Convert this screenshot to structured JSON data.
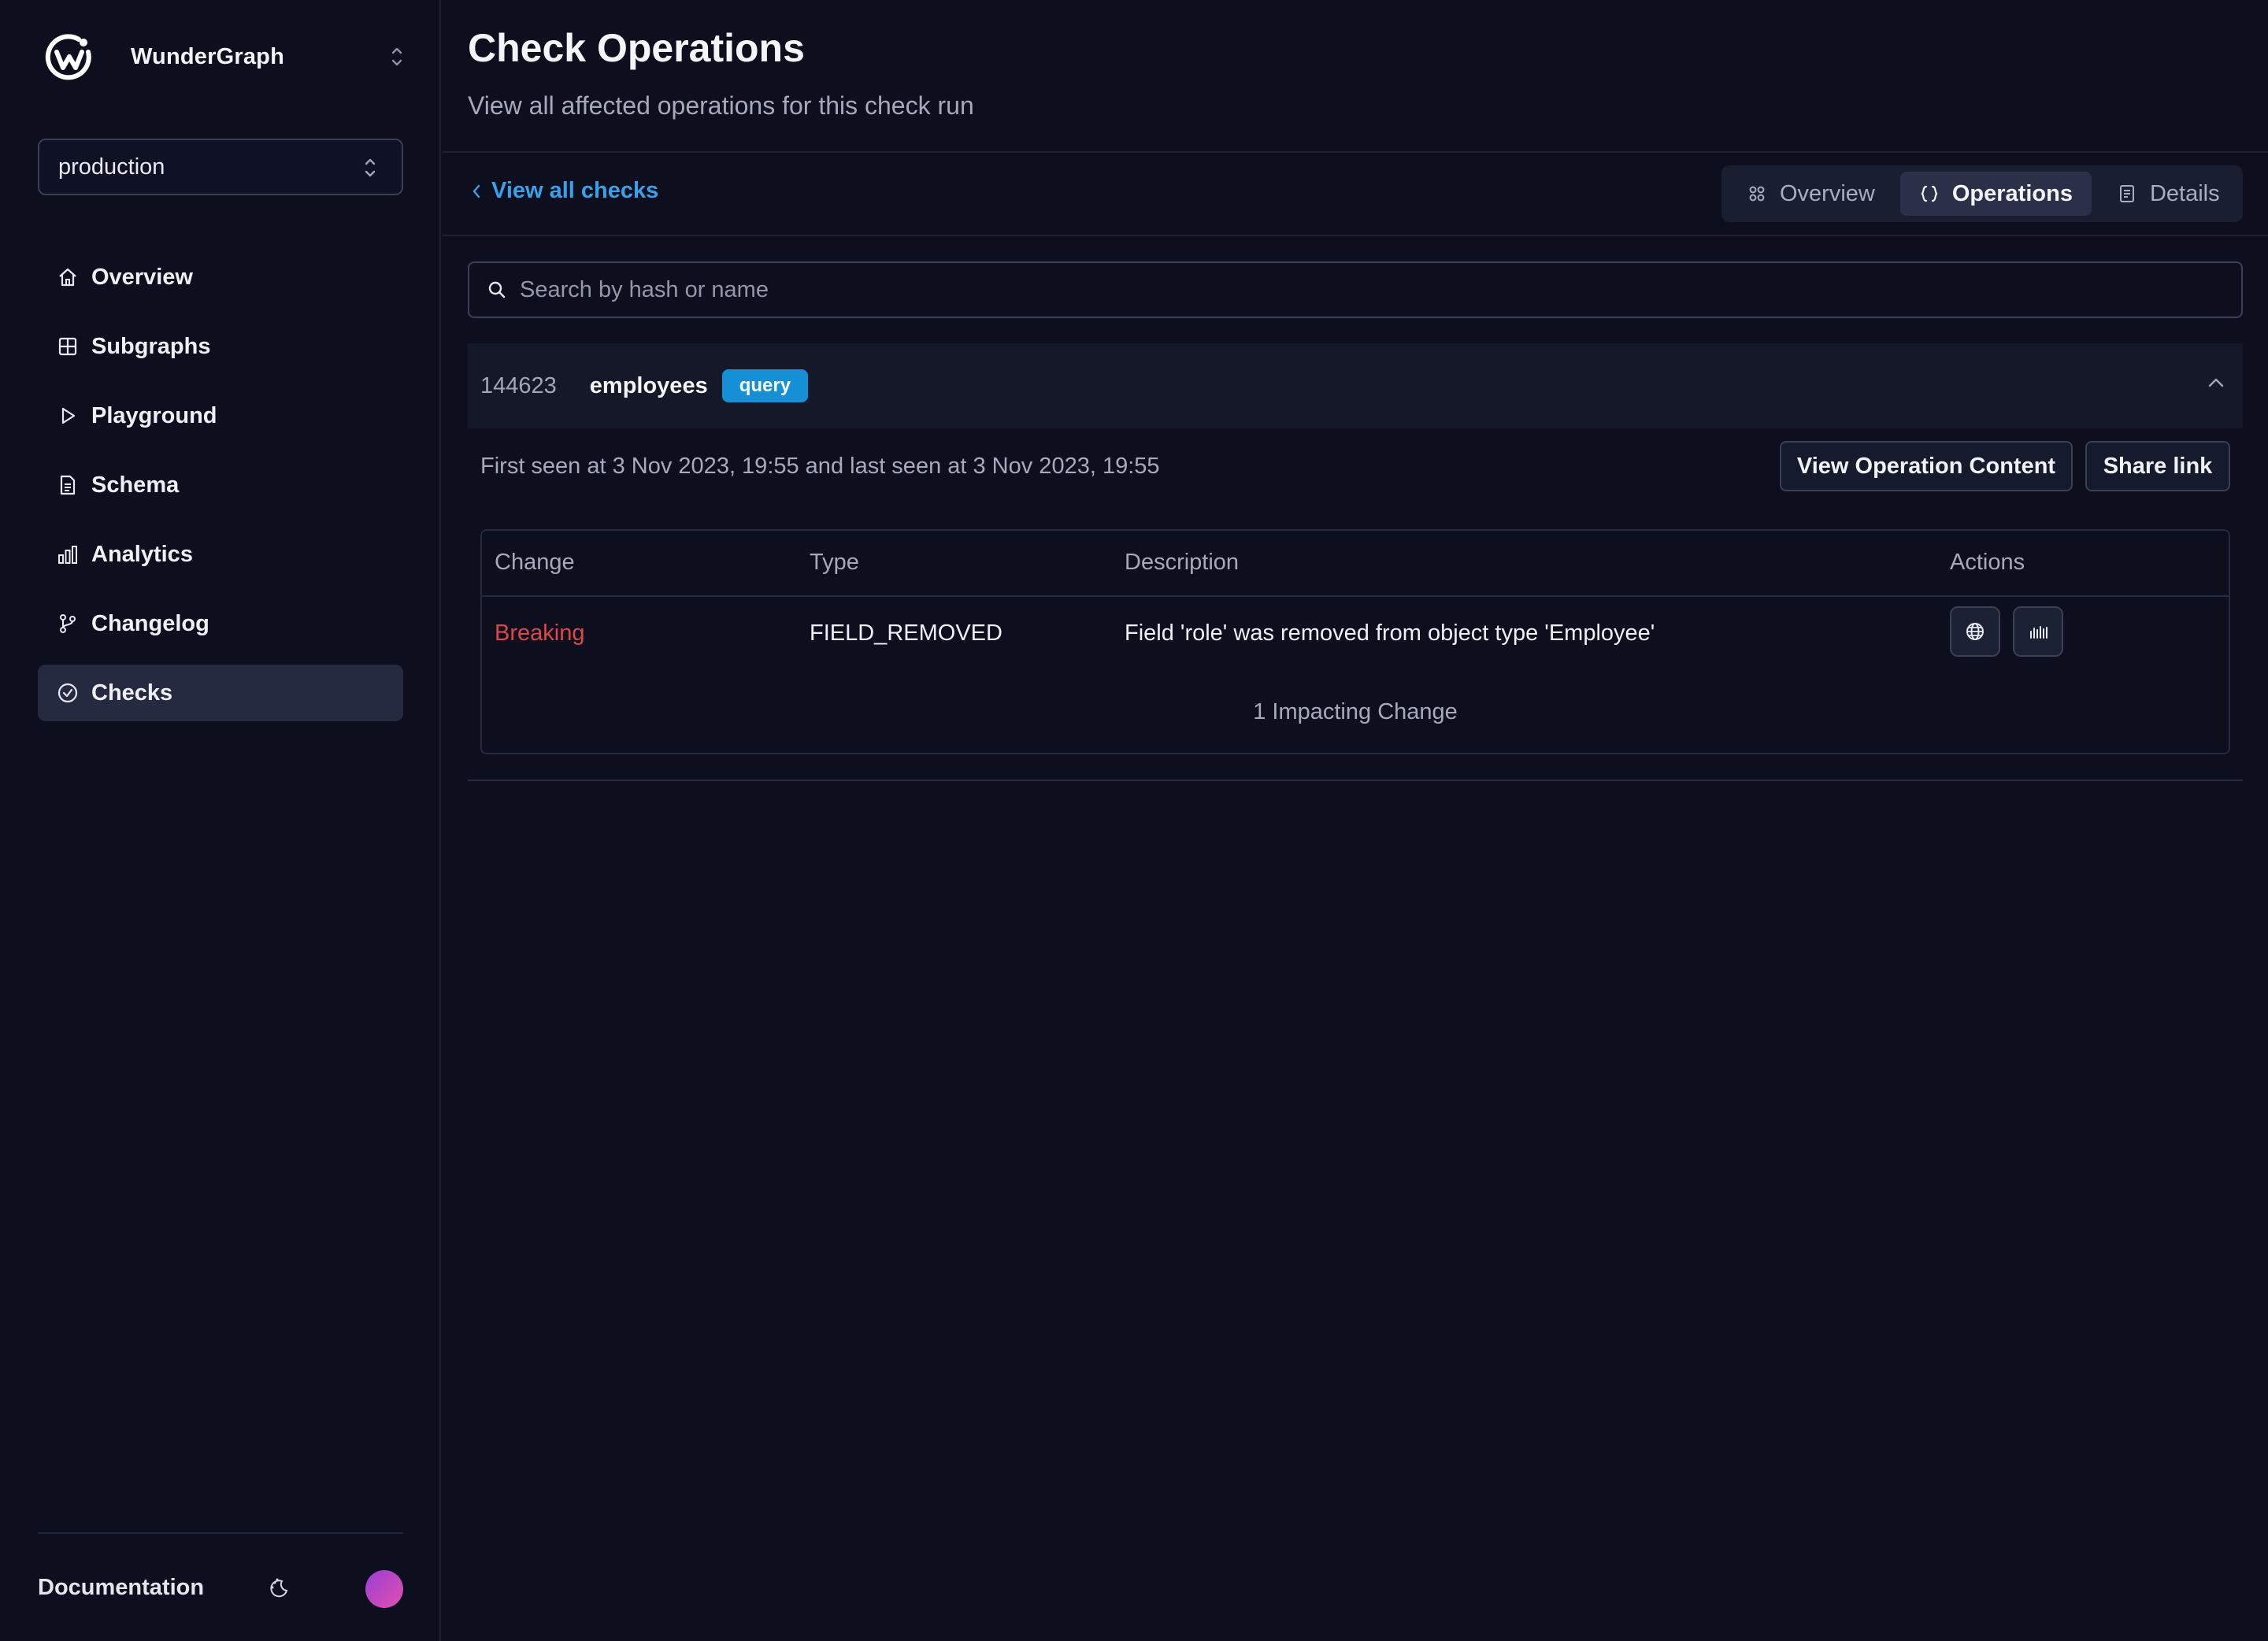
{
  "sidebar": {
    "brand_name": "WunderGraph",
    "environment": "production",
    "items": [
      {
        "label": "Overview",
        "icon": "home-icon"
      },
      {
        "label": "Subgraphs",
        "icon": "grid-icon"
      },
      {
        "label": "Playground",
        "icon": "play-icon"
      },
      {
        "label": "Schema",
        "icon": "document-icon"
      },
      {
        "label": "Analytics",
        "icon": "bar-chart-icon"
      },
      {
        "label": "Changelog",
        "icon": "git-branch-icon"
      },
      {
        "label": "Checks",
        "icon": "check-circle-icon"
      }
    ],
    "active_item": "Checks",
    "footer": {
      "documentation": "Documentation"
    }
  },
  "header": {
    "title": "Check Operations",
    "subtitle": "View all affected operations for this check run"
  },
  "toolbar": {
    "back_label": "View all checks",
    "tabs": [
      {
        "label": "Overview",
        "icon": "overview-icon"
      },
      {
        "label": "Operations",
        "icon": "braces-icon"
      },
      {
        "label": "Details",
        "icon": "details-icon"
      }
    ],
    "active_tab": "Operations"
  },
  "search": {
    "placeholder": "Search by hash or name",
    "value": ""
  },
  "operation": {
    "hash": "144623",
    "name": "employees",
    "type_badge": "query",
    "seen_text": "First seen at 3 Nov 2023, 19:55 and last seen at 3 Nov 2023, 19:55",
    "view_content_label": "View Operation Content",
    "share_label": "Share link",
    "table": {
      "headers": [
        "Change",
        "Type",
        "Description",
        "Actions"
      ],
      "rows": [
        {
          "change": "Breaking",
          "type": "FIELD_REMOVED",
          "description": "Field 'role' was removed from object type 'Employee'"
        }
      ],
      "footer": "1 Impacting Change"
    }
  },
  "colors": {
    "background": "#0d0f1f",
    "accent_link": "#3aa0e8",
    "badge": "#1590d6",
    "breaking": "#e04646"
  }
}
